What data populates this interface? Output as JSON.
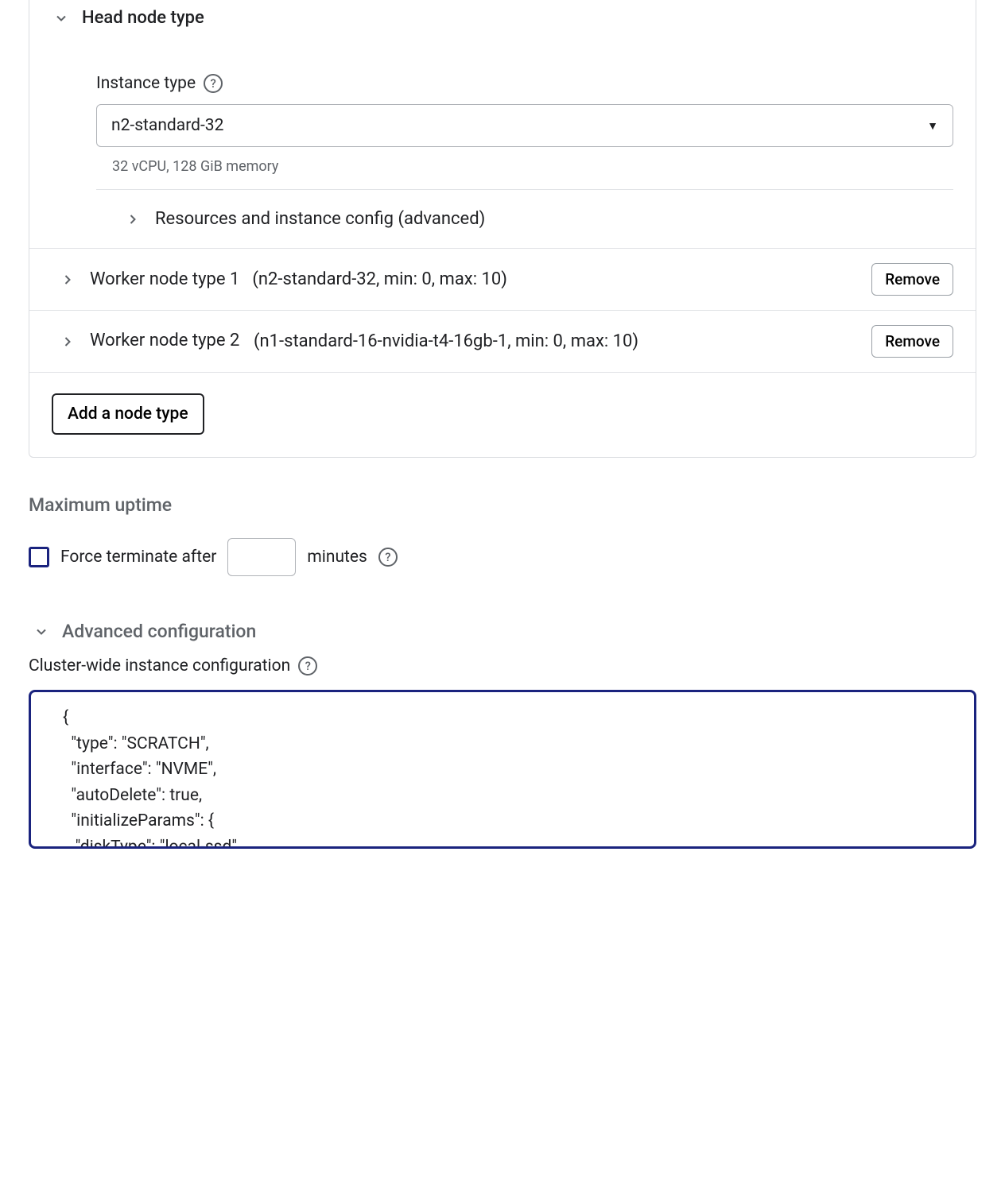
{
  "head": {
    "title": "Head node type",
    "instance_type_label": "Instance type",
    "instance_type_value": "n2-standard-32",
    "instance_specs": "32 vCPU, 128 GiB memory",
    "advanced_label": "Resources and instance config (advanced)"
  },
  "workers": [
    {
      "title": "Worker node type 1",
      "details": "(n2-standard-32, min: 0, max: 10)",
      "remove": "Remove"
    },
    {
      "title": "Worker node type 2",
      "details": "(n1-standard-16-nvidia-t4-16gb-1, min: 0, max: 10)",
      "remove": "Remove"
    }
  ],
  "add_node_button": "Add a node type",
  "uptime": {
    "heading": "Maximum uptime",
    "force_label": "Force terminate after",
    "minutes_label": "minutes",
    "value": ""
  },
  "advanced": {
    "heading": "Advanced configuration",
    "cluster_label": "Cluster-wide instance configuration",
    "code": "{\n  \"type\": \"SCRATCH\",\n  \"interface\": \"NVME\",\n  \"autoDelete\": true,\n  \"initializeParams\": {\n   \"diskType\": \"local-ssd\"\n  }"
  }
}
